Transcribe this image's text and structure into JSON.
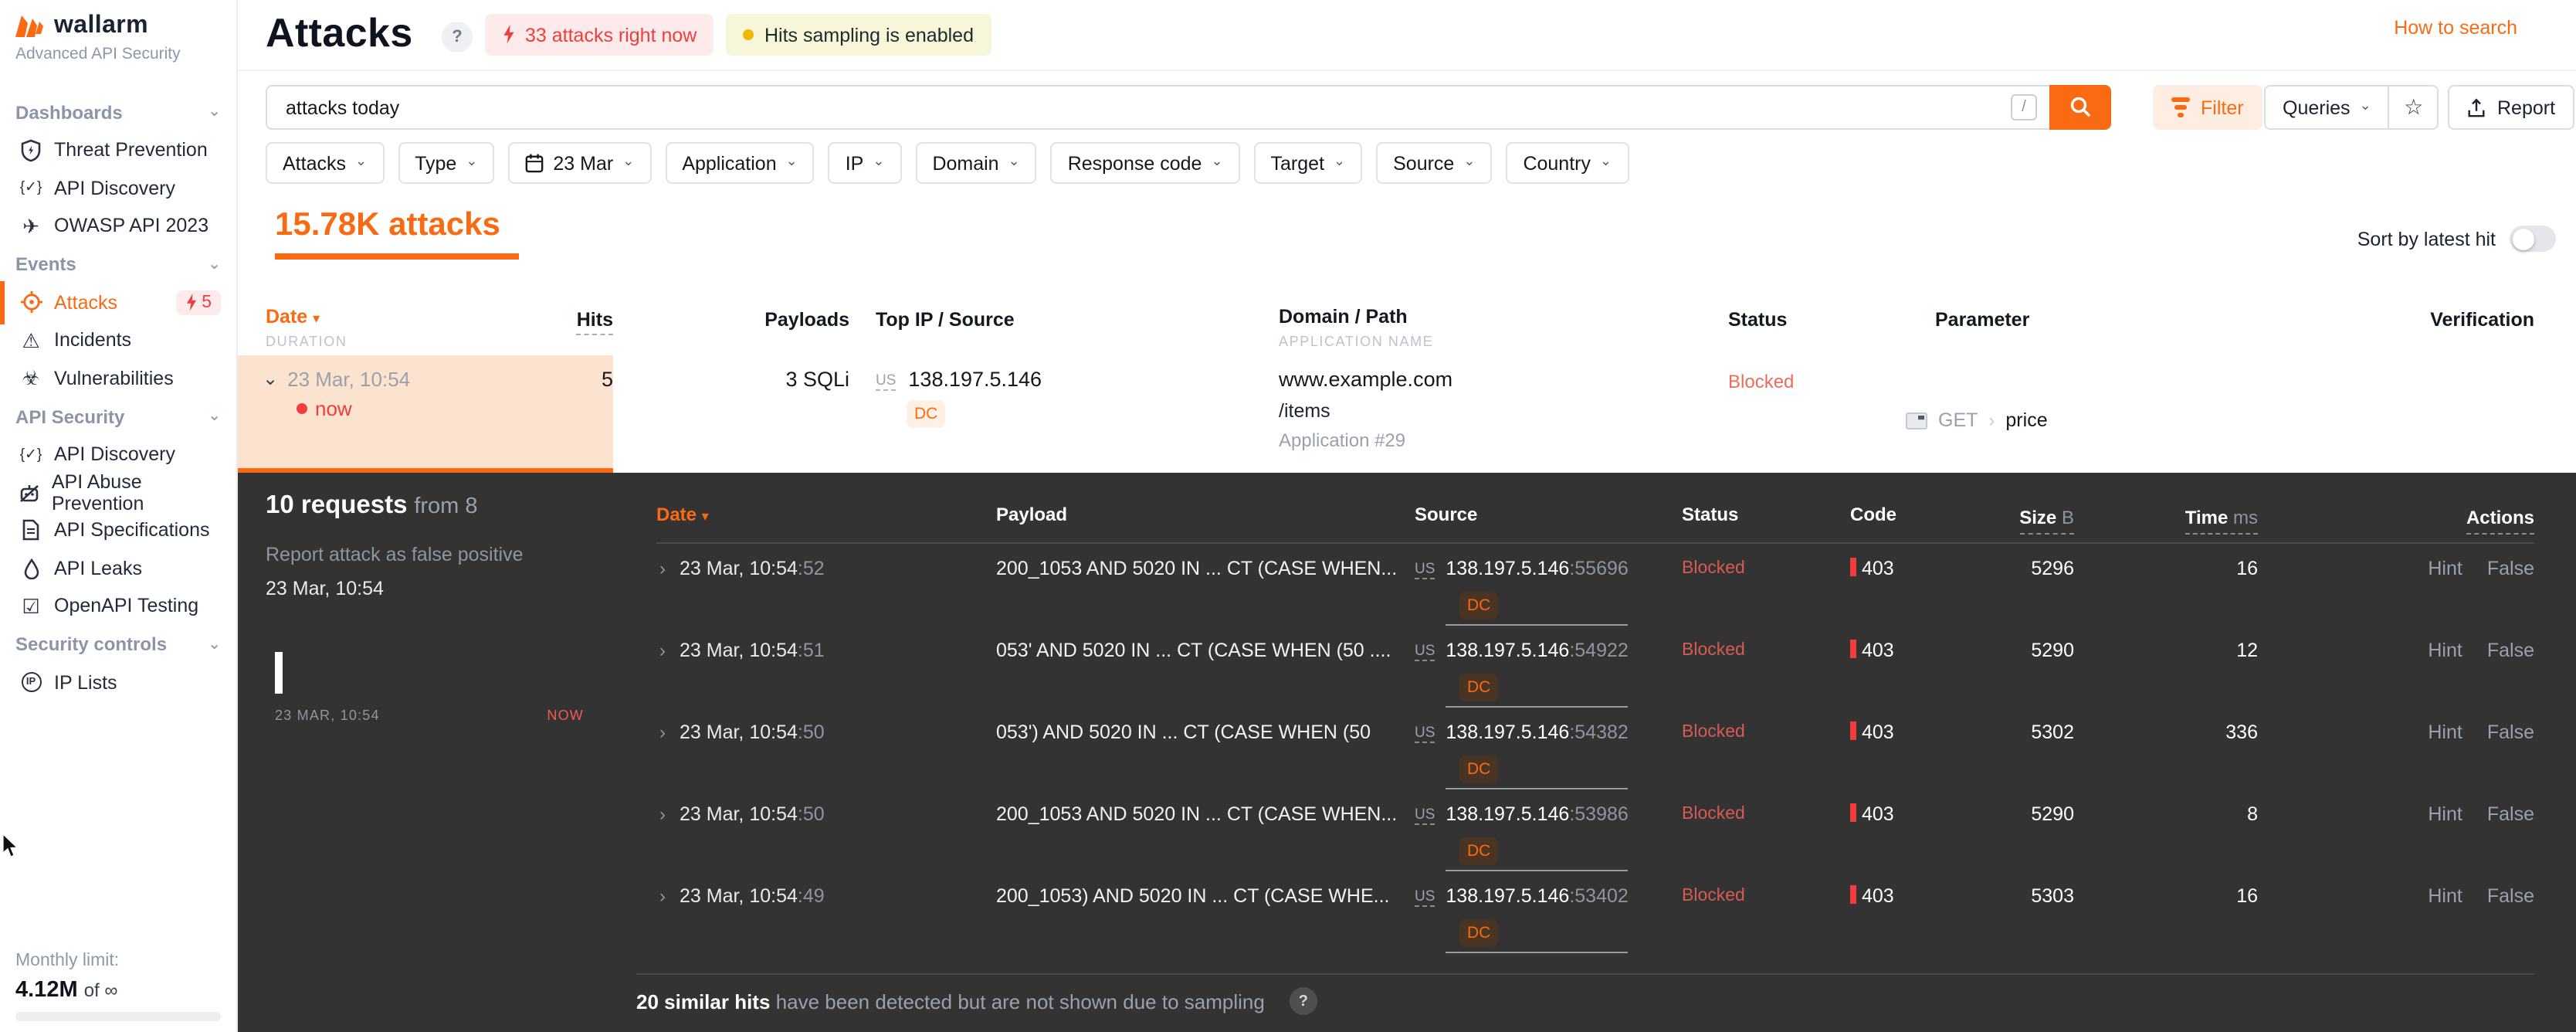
{
  "colors": {
    "accent": "#f96a13",
    "red": "#f23d3d",
    "salmon": "#ef6a5a",
    "panel_bg": "#333333",
    "peach": "#fbe3d0",
    "sampling_dot": "#f2b705"
  },
  "icons": {
    "chevron_down": "⌄",
    "chevron_right": "›",
    "caret_down": "⌄",
    "sort_desc": "▾",
    "star": "☆",
    "braces": "{✓}",
    "plane": "✈",
    "warning": "⚠",
    "biohazard": "☣",
    "checklist": "☑",
    "ip": "IP",
    "help": "?",
    "slash": "/",
    "infinity": "∞"
  },
  "brand": {
    "name": "wallarm",
    "subtitle": "Advanced API Security"
  },
  "topbar": {
    "title": "Attacks",
    "help": "?",
    "attacks_badge": "33 attacks right now",
    "sampling_badge": "Hits sampling is enabled",
    "how_to_search": "How to search"
  },
  "search": {
    "value": "attacks today",
    "shortcut": "/"
  },
  "toolbar": {
    "filter": "Filter",
    "queries": "Queries",
    "report": "Report"
  },
  "chips": [
    {
      "label": "Attacks"
    },
    {
      "label": "Type"
    },
    {
      "label": "23 Mar"
    },
    {
      "label": "Application"
    },
    {
      "label": "IP"
    },
    {
      "label": "Domain"
    },
    {
      "label": "Response code"
    },
    {
      "label": "Target"
    },
    {
      "label": "Source"
    },
    {
      "label": "Country"
    }
  ],
  "summary": {
    "count": "15.78K attacks",
    "sort_label": "Sort by latest hit"
  },
  "attack_table": {
    "headers": {
      "date": "Date",
      "duration": "DURATION",
      "hits": "Hits",
      "payloads": "Payloads",
      "top_ip": "Top IP / Source",
      "domain": "Domain / Path",
      "application": "APPLICATION NAME",
      "status": "Status",
      "parameter": "Parameter",
      "verification": "Verification"
    },
    "row": {
      "date": "23 Mar, 10:54",
      "live": "now",
      "hits": "5",
      "payloads": "3 SQLi",
      "country": "US",
      "ip": "138.197.5.146",
      "dc": "DC",
      "domain": "www.example.com",
      "path": "/items",
      "application": "Application #29",
      "status": "Blocked",
      "method": "GET",
      "parameter": "price"
    }
  },
  "details": {
    "requests_bold": "10 requests",
    "requests_rest": "from 8",
    "report_link": "Report attack as false positive",
    "time": "23 Mar, 10:54",
    "chart": {
      "start": "23 MAR, 10:54",
      "end": "NOW"
    },
    "headers": {
      "date": "Date",
      "payload": "Payload",
      "source": "Source",
      "status": "Status",
      "code": "Code",
      "size": "Size",
      "size_unit": "B",
      "time": "Time",
      "time_unit": "ms",
      "actions": "Actions"
    },
    "rows": [
      {
        "date": "23 Mar, 10:54",
        "sec": ":52",
        "payload": "200_1053 AND 5020 IN ... CT (CASE WHEN...",
        "country": "US",
        "ip": "138.197.5.146",
        "port": ":55696",
        "dc": "DC",
        "status": "Blocked",
        "code": "403",
        "size": "5296",
        "time": "16",
        "hint": "Hint",
        "false_label": "False"
      },
      {
        "date": "23 Mar, 10:54",
        "sec": ":51",
        "payload": "053' AND 5020 IN ... CT (CASE WHEN (50 ....",
        "country": "US",
        "ip": "138.197.5.146",
        "port": ":54922",
        "dc": "DC",
        "status": "Blocked",
        "code": "403",
        "size": "5290",
        "time": "12",
        "hint": "Hint",
        "false_label": "False"
      },
      {
        "date": "23 Mar, 10:54",
        "sec": ":50",
        "payload": "053') AND 5020 IN ... CT (CASE WHEN (50",
        "country": "US",
        "ip": "138.197.5.146",
        "port": ":54382",
        "dc": "DC",
        "status": "Blocked",
        "code": "403",
        "size": "5302",
        "time": "336",
        "hint": "Hint",
        "false_label": "False"
      },
      {
        "date": "23 Mar, 10:54",
        "sec": ":50",
        "payload": "200_1053 AND 5020 IN ... CT (CASE WHEN...",
        "country": "US",
        "ip": "138.197.5.146",
        "port": ":53986",
        "dc": "DC",
        "status": "Blocked",
        "code": "403",
        "size": "5290",
        "time": "8",
        "hint": "Hint",
        "false_label": "False"
      },
      {
        "date": "23 Mar, 10:54",
        "sec": ":49",
        "payload": "200_1053) AND 5020 IN ... CT (CASE WHE...",
        "country": "US",
        "ip": "138.197.5.146",
        "port": ":53402",
        "dc": "DC",
        "status": "Blocked",
        "code": "403",
        "size": "5303",
        "time": "16",
        "hint": "Hint",
        "false_label": "False"
      }
    ],
    "sampling_bold": "20 similar hits",
    "sampling_rest": "have been detected but are not shown due to sampling",
    "sampling_help": "?"
  },
  "sidebar": {
    "sections": [
      {
        "label": "Dashboards",
        "items": [
          {
            "label": "Threat Prevention"
          },
          {
            "label": "API Discovery"
          },
          {
            "label": "OWASP API 2023"
          }
        ]
      },
      {
        "label": "Events",
        "items": [
          {
            "label": "Attacks",
            "badge": "5"
          },
          {
            "label": "Incidents"
          },
          {
            "label": "Vulnerabilities"
          }
        ]
      },
      {
        "label": "API Security",
        "items": [
          {
            "label": "API Discovery"
          },
          {
            "label": "API Abuse Prevention"
          },
          {
            "label": "API Specifications"
          },
          {
            "label": "API Leaks"
          },
          {
            "label": "OpenAPI Testing"
          }
        ]
      },
      {
        "label": "Security controls",
        "items": [
          {
            "label": "IP Lists"
          }
        ]
      }
    ],
    "footer": {
      "limit_label": "Monthly limit:",
      "usage": "4.12M",
      "of_label": "of"
    }
  }
}
